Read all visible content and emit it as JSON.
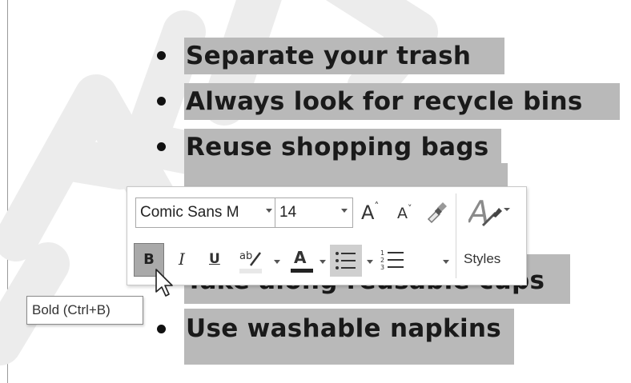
{
  "bullets": [
    {
      "text": "Separate your trash"
    },
    {
      "text": "Always look for recycle bins"
    },
    {
      "text": "Reuse shopping bags"
    },
    {
      "text": "Take along reusable cups"
    },
    {
      "text": "Use washable napkins"
    }
  ],
  "toolbar": {
    "font_name": "Comic Sans M",
    "font_size": "14",
    "styles_label": "Styles",
    "bold_label": "B",
    "italic_label": "I",
    "underline_label": "U",
    "grow_font_label": "A",
    "shrink_font_label": "A",
    "font_color_label": "A"
  },
  "tooltip": {
    "text": "Bold (Ctrl+B)"
  },
  "colors": {
    "highlight": "#b9b9b9",
    "bold_pressed": "#a9a9a9",
    "bullets_active": "#cfcfcf",
    "watermark": "#efefef"
  },
  "icons": [
    "grow-font-icon",
    "shrink-font-icon",
    "format-painter-icon",
    "styles-icon",
    "strikethrough-highlight-icon",
    "font-color-icon",
    "bullets-icon",
    "numbering-icon",
    "mouse-pointer-icon"
  ]
}
